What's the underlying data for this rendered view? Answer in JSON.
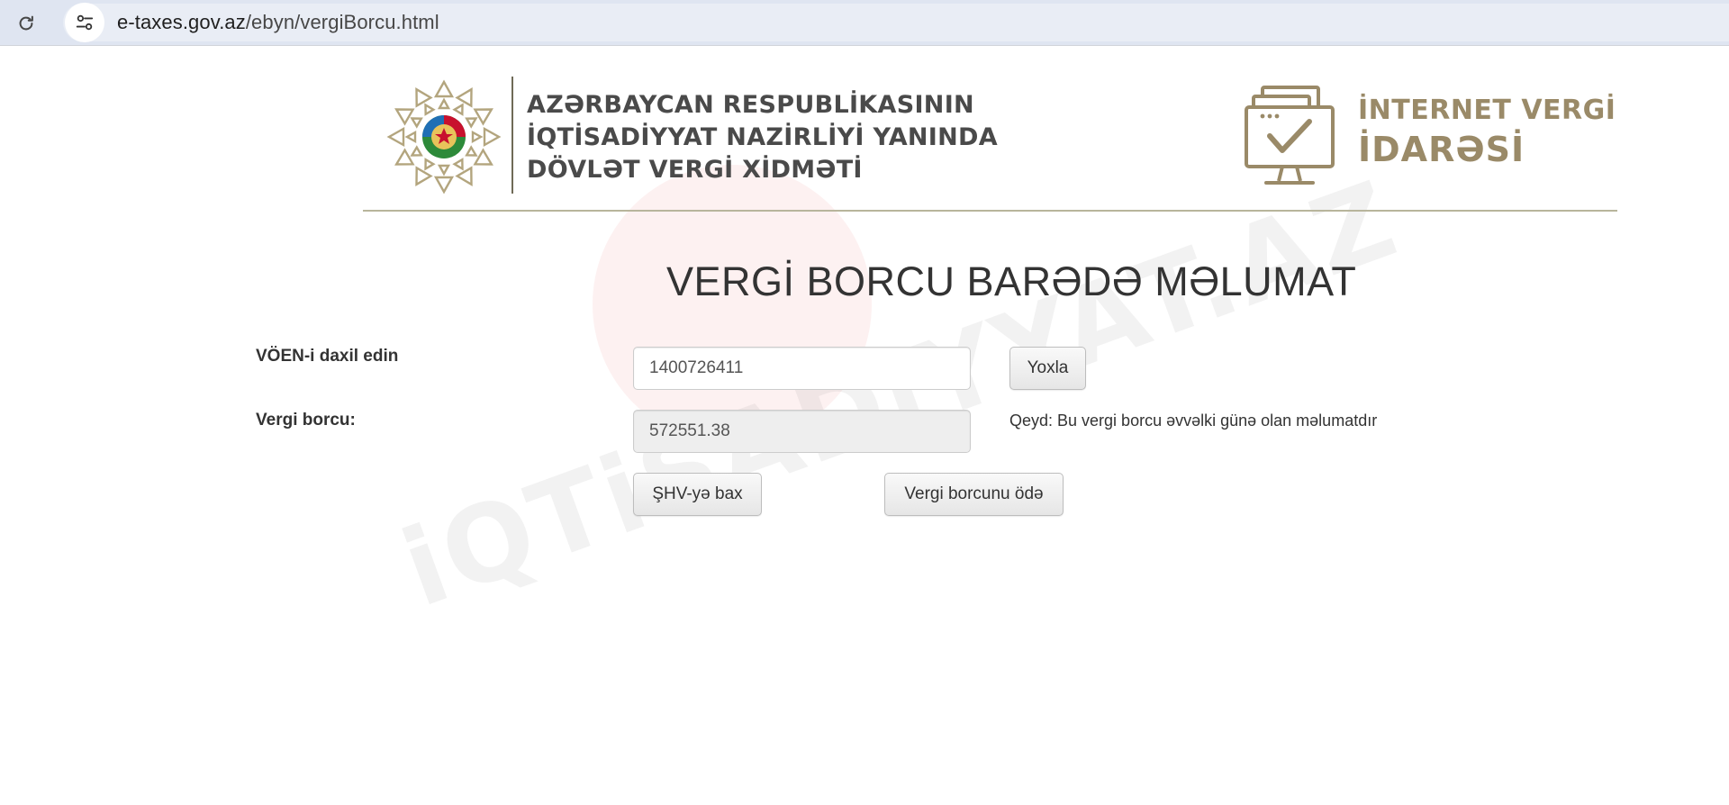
{
  "browser": {
    "url_host": "e-taxes.gov.az",
    "url_path": "/ebyn/vergiBorcu.html"
  },
  "header": {
    "agency_lines": [
      "AZƏRBAYCAN RESPUBLİKASININ",
      "İQTİSADİYYAT NAZİRLİYİ YANINDA",
      "DÖVLƏT VERGİ XİDMƏTİ"
    ],
    "ivi_line1": "İNTERNET VERGİ",
    "ivi_line2": "İDARƏSİ",
    "emblem_icon": "azerbaijan-state-emblem-icon",
    "ivi_icon": "monitor-checkmark-icon"
  },
  "main": {
    "title": "VERGİ BORCU BARƏDƏ MƏLUMAT",
    "voen_label": "VÖEN-i daxil edin",
    "voen_value": "1400726411",
    "check_button": "Yoxla",
    "debt_label": "Vergi borcu:",
    "debt_value": "572551.38",
    "note": "Qeyd: Bu vergi borcu əvvəlki günə olan məlumatdır",
    "view_account_button": "ŞHV-yə bax",
    "pay_debt_button": "Vergi borcunu ödə"
  },
  "watermark": {
    "text": "iQTiSADiYYAT.AZ"
  },
  "colors": {
    "gold": "#9a8a68",
    "header_rule": "#b8b59c",
    "browser_bar": "#dfe5f1"
  }
}
